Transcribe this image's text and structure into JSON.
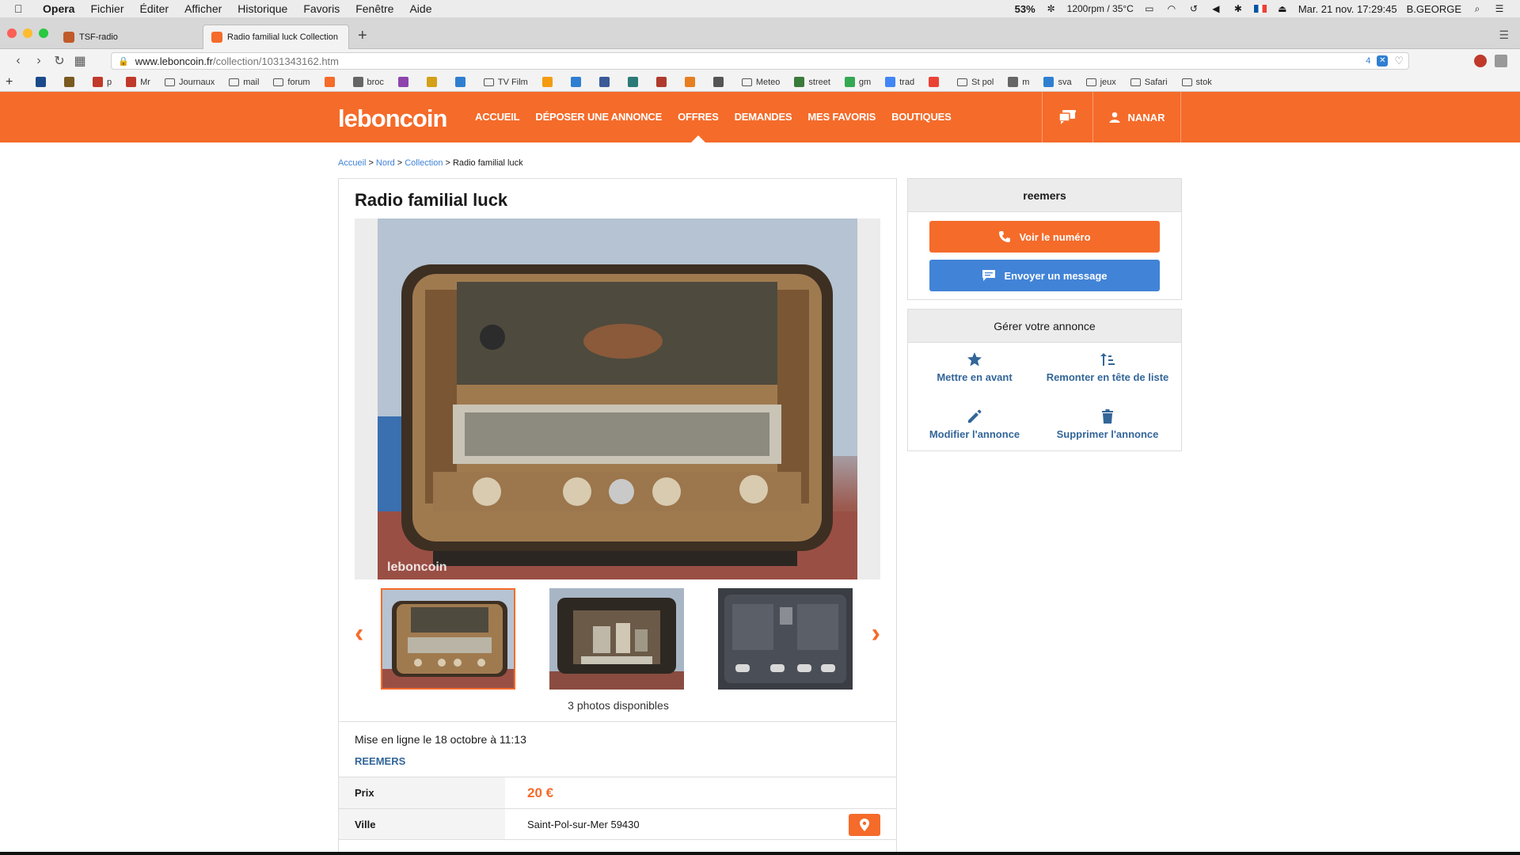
{
  "menubar": {
    "app": "Opera",
    "items": [
      "Fichier",
      "Éditer",
      "Afficher",
      "Historique",
      "Favoris",
      "Fenêtre",
      "Aide"
    ],
    "status": {
      "battery": "53%",
      "fan": "1200rpm / 35°C",
      "datetime": "Mar. 21 nov.  17:29:45",
      "user": "B.GEORGE"
    }
  },
  "tabs": [
    {
      "label": "TSF-radio",
      "color": "#c05a2a"
    },
    {
      "label": "Radio familial luck Collection",
      "color": "#f56b2a"
    }
  ],
  "address": {
    "host": "www.leboncoin.fr",
    "path": "/collection/1031343162.htm",
    "badge": "4"
  },
  "bookmarks": [
    {
      "label": "",
      "type": "icon",
      "color": "#1a4a8a"
    },
    {
      "label": "",
      "type": "icon",
      "color": "#7a5a20"
    },
    {
      "label": "p",
      "type": "icon",
      "color": "#c0392b"
    },
    {
      "label": "Mr",
      "type": "icon",
      "color": "#c0392b"
    },
    {
      "label": "Journaux",
      "type": "folder"
    },
    {
      "label": "mail",
      "type": "folder"
    },
    {
      "label": "forum",
      "type": "folder"
    },
    {
      "label": "",
      "type": "icon",
      "color": "#f56b2a"
    },
    {
      "label": "broc",
      "type": "icon",
      "color": "#666"
    },
    {
      "label": "",
      "type": "icon",
      "color": "#8e44ad"
    },
    {
      "label": "",
      "type": "icon",
      "color": "#d4a017"
    },
    {
      "label": "",
      "type": "icon",
      "color": "#2f7fd1"
    },
    {
      "label": "TV Film",
      "type": "folder"
    },
    {
      "label": "",
      "type": "icon",
      "color": "#f39c12"
    },
    {
      "label": "",
      "type": "icon",
      "color": "#2f7fd1"
    },
    {
      "label": "",
      "type": "icon",
      "color": "#3b5998"
    },
    {
      "label": "",
      "type": "icon",
      "color": "#2b7a78"
    },
    {
      "label": "",
      "type": "icon",
      "color": "#b03a2e"
    },
    {
      "label": "",
      "type": "icon",
      "color": "#e67e22"
    },
    {
      "label": "",
      "type": "icon",
      "color": "#555"
    },
    {
      "label": "Meteo",
      "type": "folder"
    },
    {
      "label": "street",
      "type": "icon",
      "color": "#3a7a3a"
    },
    {
      "label": "gm",
      "type": "icon",
      "color": "#34a853"
    },
    {
      "label": "trad",
      "type": "icon",
      "color": "#4285f4"
    },
    {
      "label": "",
      "type": "icon",
      "color": "#ea4335"
    },
    {
      "label": "St pol",
      "type": "folder"
    },
    {
      "label": "m",
      "type": "icon",
      "color": "#666"
    },
    {
      "label": "sva",
      "type": "icon",
      "color": "#2f7fd1"
    },
    {
      "label": "jeux",
      "type": "folder"
    },
    {
      "label": "Safari",
      "type": "folder"
    },
    {
      "label": "stok",
      "type": "folder"
    }
  ],
  "header": {
    "logo": "leboncoin",
    "nav": [
      {
        "label": "ACCUEIL",
        "active": false
      },
      {
        "label": "DÉPOSER UNE ANNONCE",
        "active": false
      },
      {
        "label": "OFFRES",
        "active": true
      },
      {
        "label": "DEMANDES",
        "active": false
      },
      {
        "label": "MES FAVORIS",
        "active": false
      },
      {
        "label": "BOUTIQUES",
        "active": false
      }
    ],
    "user": "NANAR"
  },
  "breadcrumb": {
    "items": [
      "Accueil",
      "Nord",
      "Collection"
    ],
    "current": "Radio familial luck"
  },
  "ad": {
    "title": "Radio familial luck",
    "watermark": "leboncoin",
    "photos_count": "3 photos disponibles",
    "date": "Mise en ligne le 18 octobre à 11:13",
    "seller": "REEMERS",
    "price_label": "Prix",
    "price": "20 €",
    "city_label": "Ville",
    "city": "Saint-Pol-sur-Mer 59430"
  },
  "sidebar": {
    "seller_name": "reemers",
    "call_button": "Voir le numéro",
    "message_button": "Envoyer un message",
    "manage_title": "Gérer votre annonce",
    "actions": [
      {
        "label": "Mettre en avant",
        "icon": "star-icon"
      },
      {
        "label": "Remonter en tête de liste",
        "icon": "sort-up-icon"
      },
      {
        "label": "Modifier l'annonce",
        "icon": "pencil-icon"
      },
      {
        "label": "Supprimer l'annonce",
        "icon": "trash-icon"
      }
    ]
  },
  "colors": {
    "brand": "#f56b2a",
    "blue": "#4183d7",
    "link": "#336699"
  }
}
